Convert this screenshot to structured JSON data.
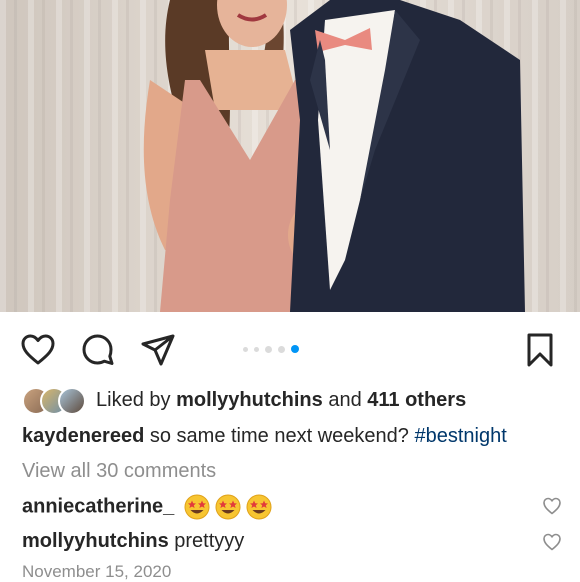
{
  "post": {
    "likes": {
      "prefix": "Liked by",
      "user": "mollyyhutchins",
      "connector": "and",
      "others": "411 others"
    },
    "caption": {
      "username": "kaydenereed",
      "text": "so same time next weekend?",
      "hashtag": "#bestnight"
    },
    "view_all_comments": "View all 30 comments",
    "comments": [
      {
        "username": "anniecatherine_",
        "text": "",
        "emojis": [
          "star-struck-emoji",
          "star-struck-emoji",
          "star-struck-emoji"
        ]
      },
      {
        "username": "mollyyhutchins",
        "text": "prettyyy"
      }
    ],
    "date": "November 15, 2020"
  },
  "carousel": {
    "count": 5,
    "active_index": 4
  },
  "colors": {
    "accent": "#0095f6",
    "hashtag": "#00376b",
    "muted": "#8e8e8e",
    "text": "#262626"
  },
  "icons": [
    "heart-icon",
    "comment-icon",
    "share-icon",
    "bookmark-icon"
  ]
}
